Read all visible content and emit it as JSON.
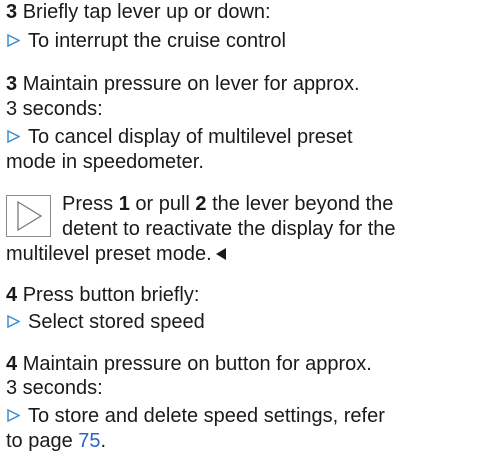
{
  "blocks": [
    {
      "step": "3",
      "heading": "Briefly tap lever up or down:",
      "results": [
        "To interrupt the cruise control"
      ]
    },
    {
      "step": "3",
      "heading_line1": "Maintain pressure on lever for approx.",
      "heading_line2": "3 seconds:",
      "result_line1": "To cancel display of multilevel preset",
      "result_line2": "mode in speedometer."
    }
  ],
  "note": {
    "line1_a": "Press ",
    "line1_b": "1",
    "line1_c": " or pull ",
    "line1_d": "2",
    "line1_e": " the lever beyond the",
    "line2": "detent to reactivate the display for the",
    "line3": "multilevel preset mode."
  },
  "block4a": {
    "step": "4",
    "heading": "Press button briefly:",
    "result": "Select stored speed"
  },
  "block4b": {
    "step": "4",
    "heading_line1": "Maintain pressure on button for approx.",
    "heading_line2": "3 seconds:",
    "result_line1": "To store and delete speed settings, refer",
    "result_line2_a": "to page ",
    "result_line2_link": "75",
    "result_line2_c": "."
  },
  "colors": {
    "text": "#1a1a1a",
    "arrow": "#3a8fd6",
    "link": "#2b62c8"
  },
  "icons": {
    "result_marker": "triangle-right-outline-icon",
    "note_marker": "note-triangle-icon",
    "end_marker": "end-of-section-icon"
  }
}
